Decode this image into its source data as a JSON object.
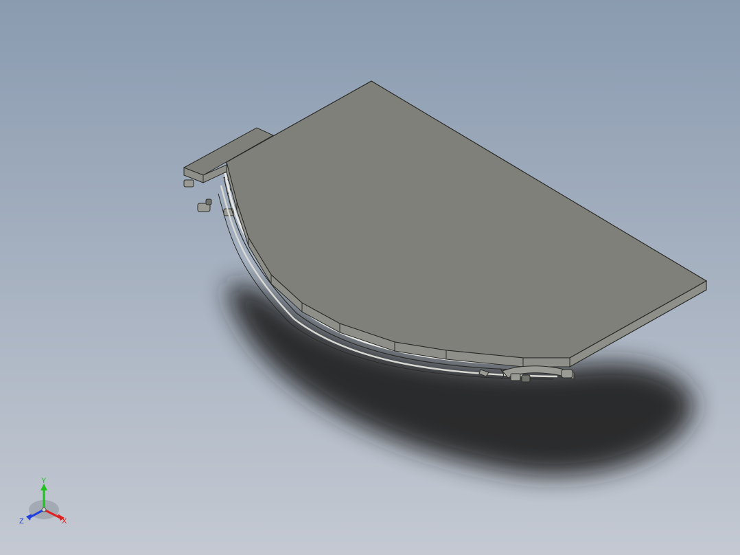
{
  "viewport": {
    "background_top": "#8a9bb0",
    "background_bottom": "#c4c9d2"
  },
  "model": {
    "top_face_color": "#7f807a",
    "edge_face_color": "#8e8f88",
    "outline_color": "#2a2b28",
    "shadow_color": "#1c1c1c"
  },
  "triad": {
    "x_label": "X",
    "y_label": "Y",
    "z_label": "Z",
    "x_color": "#e02020",
    "y_color": "#20c020",
    "z_color": "#2040e0"
  }
}
